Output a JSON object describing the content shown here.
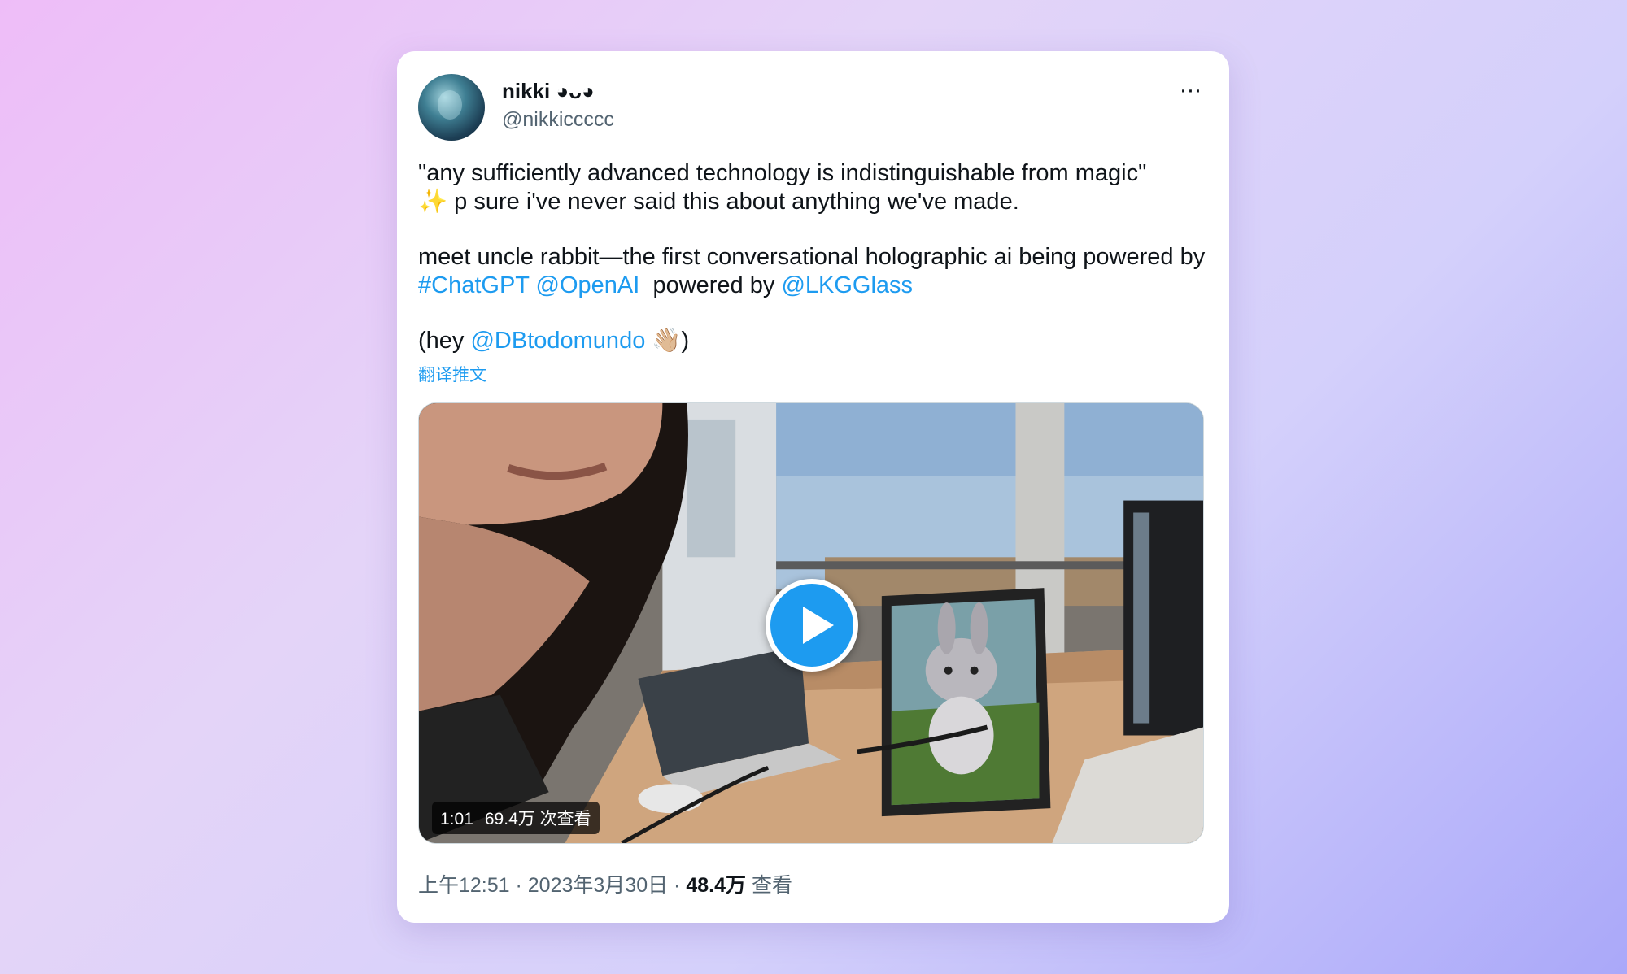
{
  "author": {
    "name": "nikki ◕ᴗ◕",
    "handle": "@nikkiccccc"
  },
  "icons": {
    "more": "more-horizontal-icon",
    "play": "play-icon",
    "sparkles": "sparkles-emoji",
    "waving_hand": "waving-hand-emoji"
  },
  "tweet": {
    "line1": "\"any sufficiently advanced technology is indistinguishable from magic\"",
    "sparkles": "✨",
    "line2": " p sure i've never said this about anything we've made.",
    "line3": "meet uncle rabbit—the first conversational holographic ai being powered by ",
    "hashtag_chatgpt": "#ChatGPT",
    "mention_openai": "@OpenAI",
    "powered_by": "  powered by ",
    "mention_lkg": "@LKGGlass",
    "hey_prefix": "(hey ",
    "mention_db": "@DBtodomundo",
    "wave": " 👋🏼",
    "hey_suffix": ")"
  },
  "translate_label": "翻译推文",
  "video": {
    "duration": "1:01",
    "views": "69.4万 次查看"
  },
  "meta": {
    "time_date": "上午12:51 · 2023年3月30日 · ",
    "view_count": "48.4万",
    "view_label": " 查看"
  },
  "colors": {
    "link": "#1d9bf0",
    "text": "#0f1419",
    "secondary": "#536471"
  }
}
